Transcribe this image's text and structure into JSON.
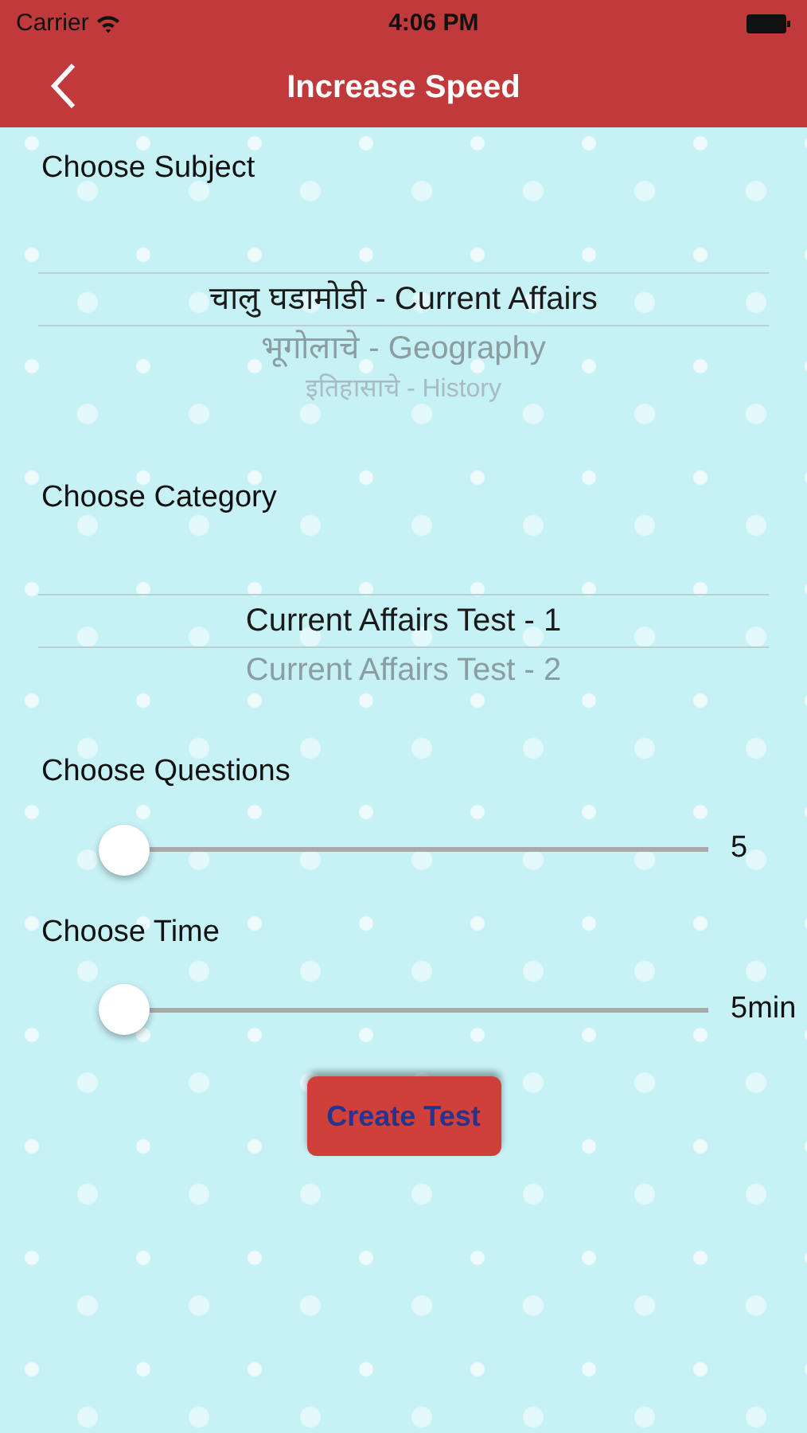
{
  "status_bar": {
    "carrier": "Carrier",
    "time": "4:06 PM"
  },
  "nav": {
    "title": "Increase Speed"
  },
  "sections": [
    {
      "kind": "picker",
      "label": "Choose Subject",
      "items": [
        {
          "label": "चालु घडामोडी - Current Affairs",
          "selected": true
        },
        {
          "label": "भूगोलाचे - Geography",
          "selected": false
        },
        {
          "label": "इतिहासाचे - History",
          "selected": false
        }
      ]
    },
    {
      "kind": "picker",
      "label": "Choose Category",
      "items": [
        {
          "label": "Current Affairs Test - 1",
          "selected": true
        },
        {
          "label": "Current Affairs Test - 2",
          "selected": false
        }
      ]
    },
    {
      "kind": "slider",
      "label": "Choose Questions",
      "level": 0,
      "reading": "5"
    },
    {
      "kind": "slider",
      "label": "Choose Time",
      "level": 0,
      "reading": "5min"
    }
  ],
  "button": {
    "label": "Create Test"
  }
}
